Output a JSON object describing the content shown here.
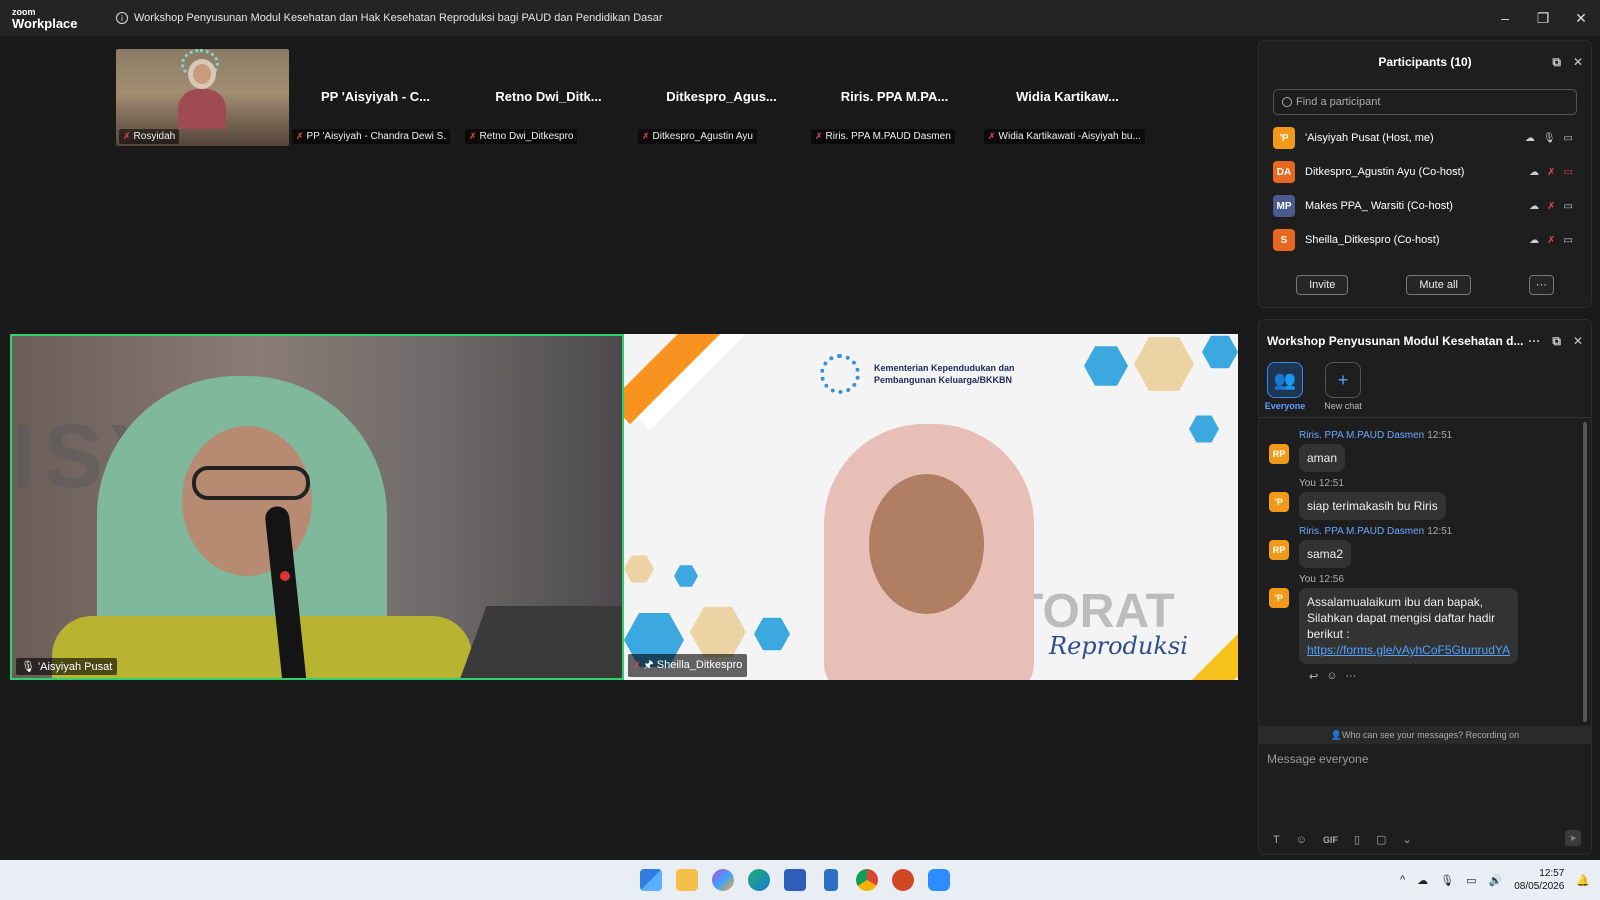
{
  "app": {
    "logo_top": "zoom",
    "logo_bottom": "Workplace",
    "meeting_title": "Workshop Penyusunan Modul Kesehatan dan Hak Kesehatan Reproduksi bagi PAUD dan Pendidikan Dasar",
    "info_icon": "i"
  },
  "window": {
    "minimize": "–",
    "restore": "❐",
    "close": "✕"
  },
  "strip": [
    {
      "display_name": "",
      "tag": "Rosyidah",
      "has_video": true
    },
    {
      "display_name": "PP 'Aisyiyah - C...",
      "tag": "PP 'Aisyiyah - Chandra Dewi S.",
      "has_video": false
    },
    {
      "display_name": "Retno Dwi_Ditk...",
      "tag": "Retno Dwi_Ditkespro",
      "has_video": false
    },
    {
      "display_name": "Ditkespro_Agus...",
      "tag": "Ditkespro_Agustin Ayu",
      "has_video": false
    },
    {
      "display_name": "Riris. PPA M.PA...",
      "tag": "Riris. PPA M.PAUD Dasmen",
      "has_video": false
    },
    {
      "display_name": "Widia Kartikaw...",
      "tag": "Widia Kartikawati -Aisyiyah bu...",
      "has_video": false
    }
  ],
  "main": {
    "left_tag": "'Aisyiyah Pusat",
    "right_tag": "Sheilla_Ditkespro",
    "slide_ministry_line1": "Kementerian Kependudukan dan",
    "slide_ministry_line2": "Pembangunan Keluarga/BKKBN",
    "slide_word": "TORAT",
    "slide_word2": "Reproduksi"
  },
  "participants": {
    "title": "Participants (10)",
    "search_placeholder": "Find a participant",
    "rows": [
      {
        "initials": "'P",
        "name": "'Aisyiyah Pusat (Host, me)",
        "color": "#f19a1a",
        "mic_muted": false,
        "video_off": false
      },
      {
        "initials": "DA",
        "name": "Ditkespro_Agustin Ayu (Co-host)",
        "color": "#e8681f",
        "mic_muted": true,
        "video_off": true
      },
      {
        "initials": "MP",
        "name": "Makes PPA_ Warsiti (Co-host)",
        "color": "#4a5a8c",
        "mic_muted": true,
        "video_off": false
      },
      {
        "initials": "S",
        "name": "Sheilla_Ditkespro (Co-host)",
        "color": "#e8681f",
        "mic_muted": true,
        "video_off": false
      }
    ],
    "invite": "Invite",
    "mute_all": "Mute all",
    "more": "···"
  },
  "chat": {
    "title": "Workshop Penyusunan Modul Kesehatan d...",
    "tabs": [
      {
        "label": "Everyone",
        "icon": "people-icon"
      },
      {
        "label": "New chat",
        "icon": "plus-icon"
      }
    ],
    "messages": [
      {
        "avatar": "RP",
        "sender": "Riris. PPA M.PAUD Dasmen",
        "time": "12:51",
        "text": "aman",
        "me": false
      },
      {
        "avatar": "'P",
        "sender": "You",
        "time": "12:51",
        "text": "siap terimakasih bu Riris",
        "me": true
      },
      {
        "avatar": "RP",
        "sender": "Riris. PPA M.PAUD Dasmen",
        "time": "12:51",
        "text": "sama2",
        "me": false
      }
    ],
    "last_message": {
      "avatar": "'P",
      "sender": "You",
      "time": "12:56",
      "line1": "Assalamualaikum ibu dan bapak,",
      "line2": "Silahkan dapat mengisi daftar hadir",
      "line3": "berikut :",
      "link": "https://forms.gle/vAyhCoF5GtunrudYA"
    },
    "recording_note": "Who can see your messages? Recording on",
    "input_placeholder": "Message everyone"
  },
  "taskbar": {
    "time": "12:57",
    "date": "08/05/2026"
  }
}
